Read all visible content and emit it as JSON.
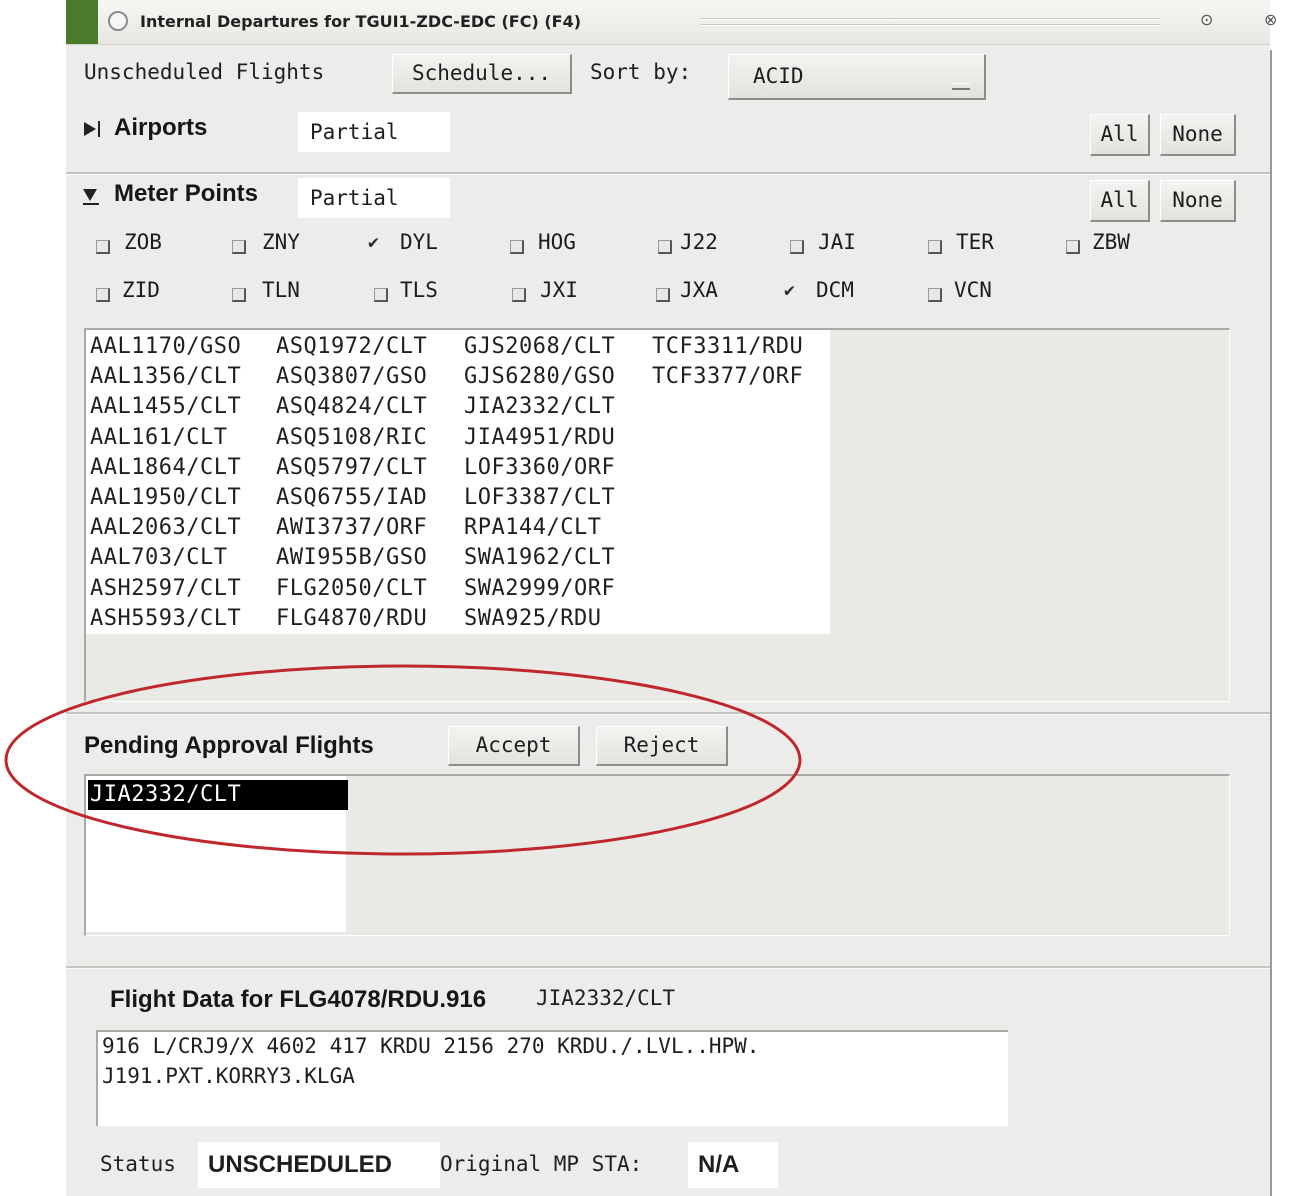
{
  "window": {
    "title": "Internal Departures for TGUI1-ZDC-EDC (FC) (F4)"
  },
  "toolbar": {
    "unscheduled_label": "Unscheduled Flights",
    "schedule_button": "Schedule...",
    "sort_label": "Sort by:",
    "sort_value": "ACID"
  },
  "airports": {
    "label": "Airports",
    "value": "Partial",
    "all": "All",
    "none": "None"
  },
  "meter_points": {
    "label": "Meter Points",
    "value": "Partial",
    "all": "All",
    "none": "None",
    "items": [
      {
        "label": "ZOB",
        "checked": false
      },
      {
        "label": "ZNY",
        "checked": false
      },
      {
        "label": "DYL",
        "checked": true
      },
      {
        "label": "HOG",
        "checked": false
      },
      {
        "label": "J22",
        "checked": false
      },
      {
        "label": "JAI",
        "checked": false
      },
      {
        "label": "TER",
        "checked": false
      },
      {
        "label": "ZBW",
        "checked": false
      },
      {
        "label": "ZID",
        "checked": false
      },
      {
        "label": "TLN",
        "checked": false
      },
      {
        "label": "TLS",
        "checked": false
      },
      {
        "label": "JXI",
        "checked": false
      },
      {
        "label": "JXA",
        "checked": false
      },
      {
        "label": "DCM",
        "checked": true
      },
      {
        "label": "VCN",
        "checked": false
      }
    ]
  },
  "unscheduled_list": {
    "columns": [
      [
        "AAL1170/GSO",
        "AAL1356/CLT",
        "AAL1455/CLT",
        "AAL161/CLT",
        "AAL1864/CLT",
        "AAL1950/CLT",
        "AAL2063/CLT",
        "AAL703/CLT",
        "ASH2597/CLT",
        "ASH5593/CLT"
      ],
      [
        "ASQ1972/CLT",
        "ASQ3807/GSO",
        "ASQ4824/CLT",
        "ASQ5108/RIC",
        "ASQ5797/CLT",
        "ASQ6755/IAD",
        "AWI3737/ORF",
        "AWI955B/GSO",
        "FLG2050/CLT",
        "FLG4870/RDU"
      ],
      [
        "GJS2068/CLT",
        "GJS6280/GSO",
        "JIA2332/CLT",
        "JIA4951/RDU",
        "LOF3360/ORF",
        "LOF3387/CLT",
        "RPA144/CLT",
        "SWA1962/CLT",
        "SWA2999/ORF",
        "SWA925/RDU"
      ],
      [
        "TCF3311/RDU",
        "TCF3377/ORF"
      ]
    ]
  },
  "pending": {
    "label": "Pending Approval Flights",
    "accept": "Accept",
    "reject": "Reject",
    "items": [
      "JIA2332/CLT"
    ]
  },
  "flight_data": {
    "label": "Flight Data for FLG4078/RDU.916",
    "selected": "JIA2332/CLT",
    "line1": "916 L/CRJ9/X 4602 417 KRDU 2156 270 KRDU./.LVL..HPW.",
    "line2": "J191.PXT.KORRY3.KLGA",
    "status_label": "Status",
    "status_value": "UNSCHEDULED",
    "orig_label": "Original MP STA:",
    "orig_value": "N/A"
  },
  "colors": {
    "annotation": "#c0272d",
    "title_strip": "#4a7a2c"
  }
}
